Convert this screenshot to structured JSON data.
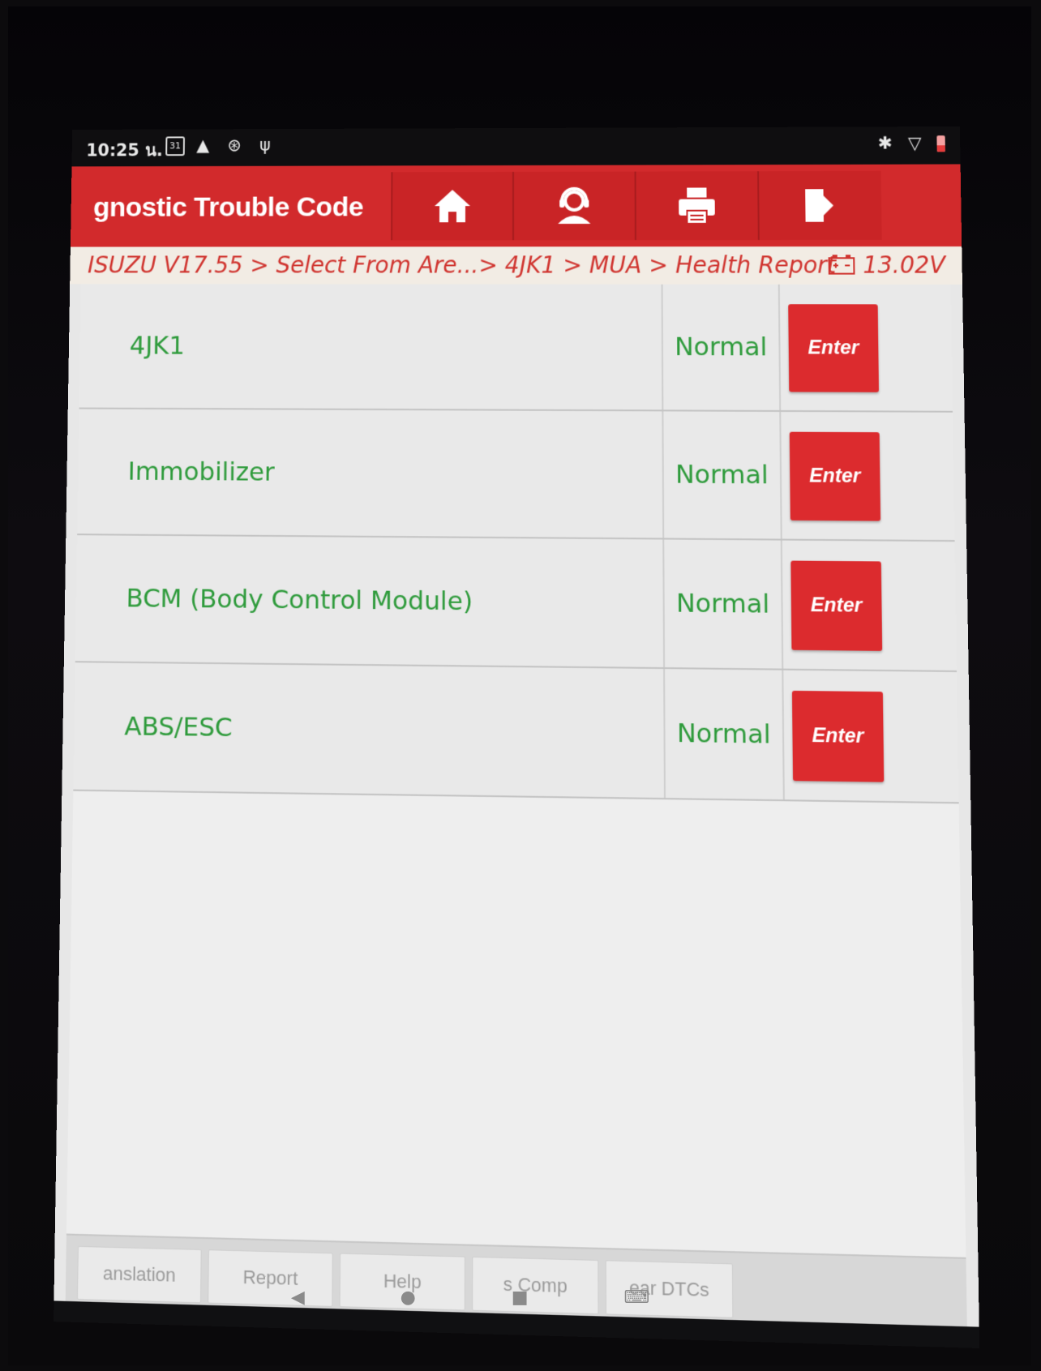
{
  "status_bar": {
    "time": "10:25 น.",
    "calendar_day": "31"
  },
  "header": {
    "title": "ɡnostic Trouble Code",
    "tool_icons": [
      "home-icon",
      "support-agent-icon",
      "printer-icon",
      "exit-icon"
    ]
  },
  "breadcrumb": {
    "path": "ISUZU V17.55 > Select From Are...> 4JK1 > MUA > Health Report",
    "voltage": "13.02V"
  },
  "systems": [
    {
      "name": "4JK1",
      "status": "Normal",
      "action": "Enter"
    },
    {
      "name": "Immobilizer",
      "status": "Normal",
      "action": "Enter"
    },
    {
      "name": "BCM (Body Control Module)",
      "status": "Normal",
      "action": "Enter"
    },
    {
      "name": "ABS/ESC",
      "status": "Normal",
      "action": "Enter"
    }
  ],
  "bottom_bar": {
    "buttons": [
      "anslation",
      "Report",
      "Help",
      "s    Comp",
      "ear DTCs"
    ]
  },
  "colors": {
    "header_red": "#d22a2c",
    "status_green": "#2f9b3c",
    "breadcrumb_text": "#d0342f"
  }
}
